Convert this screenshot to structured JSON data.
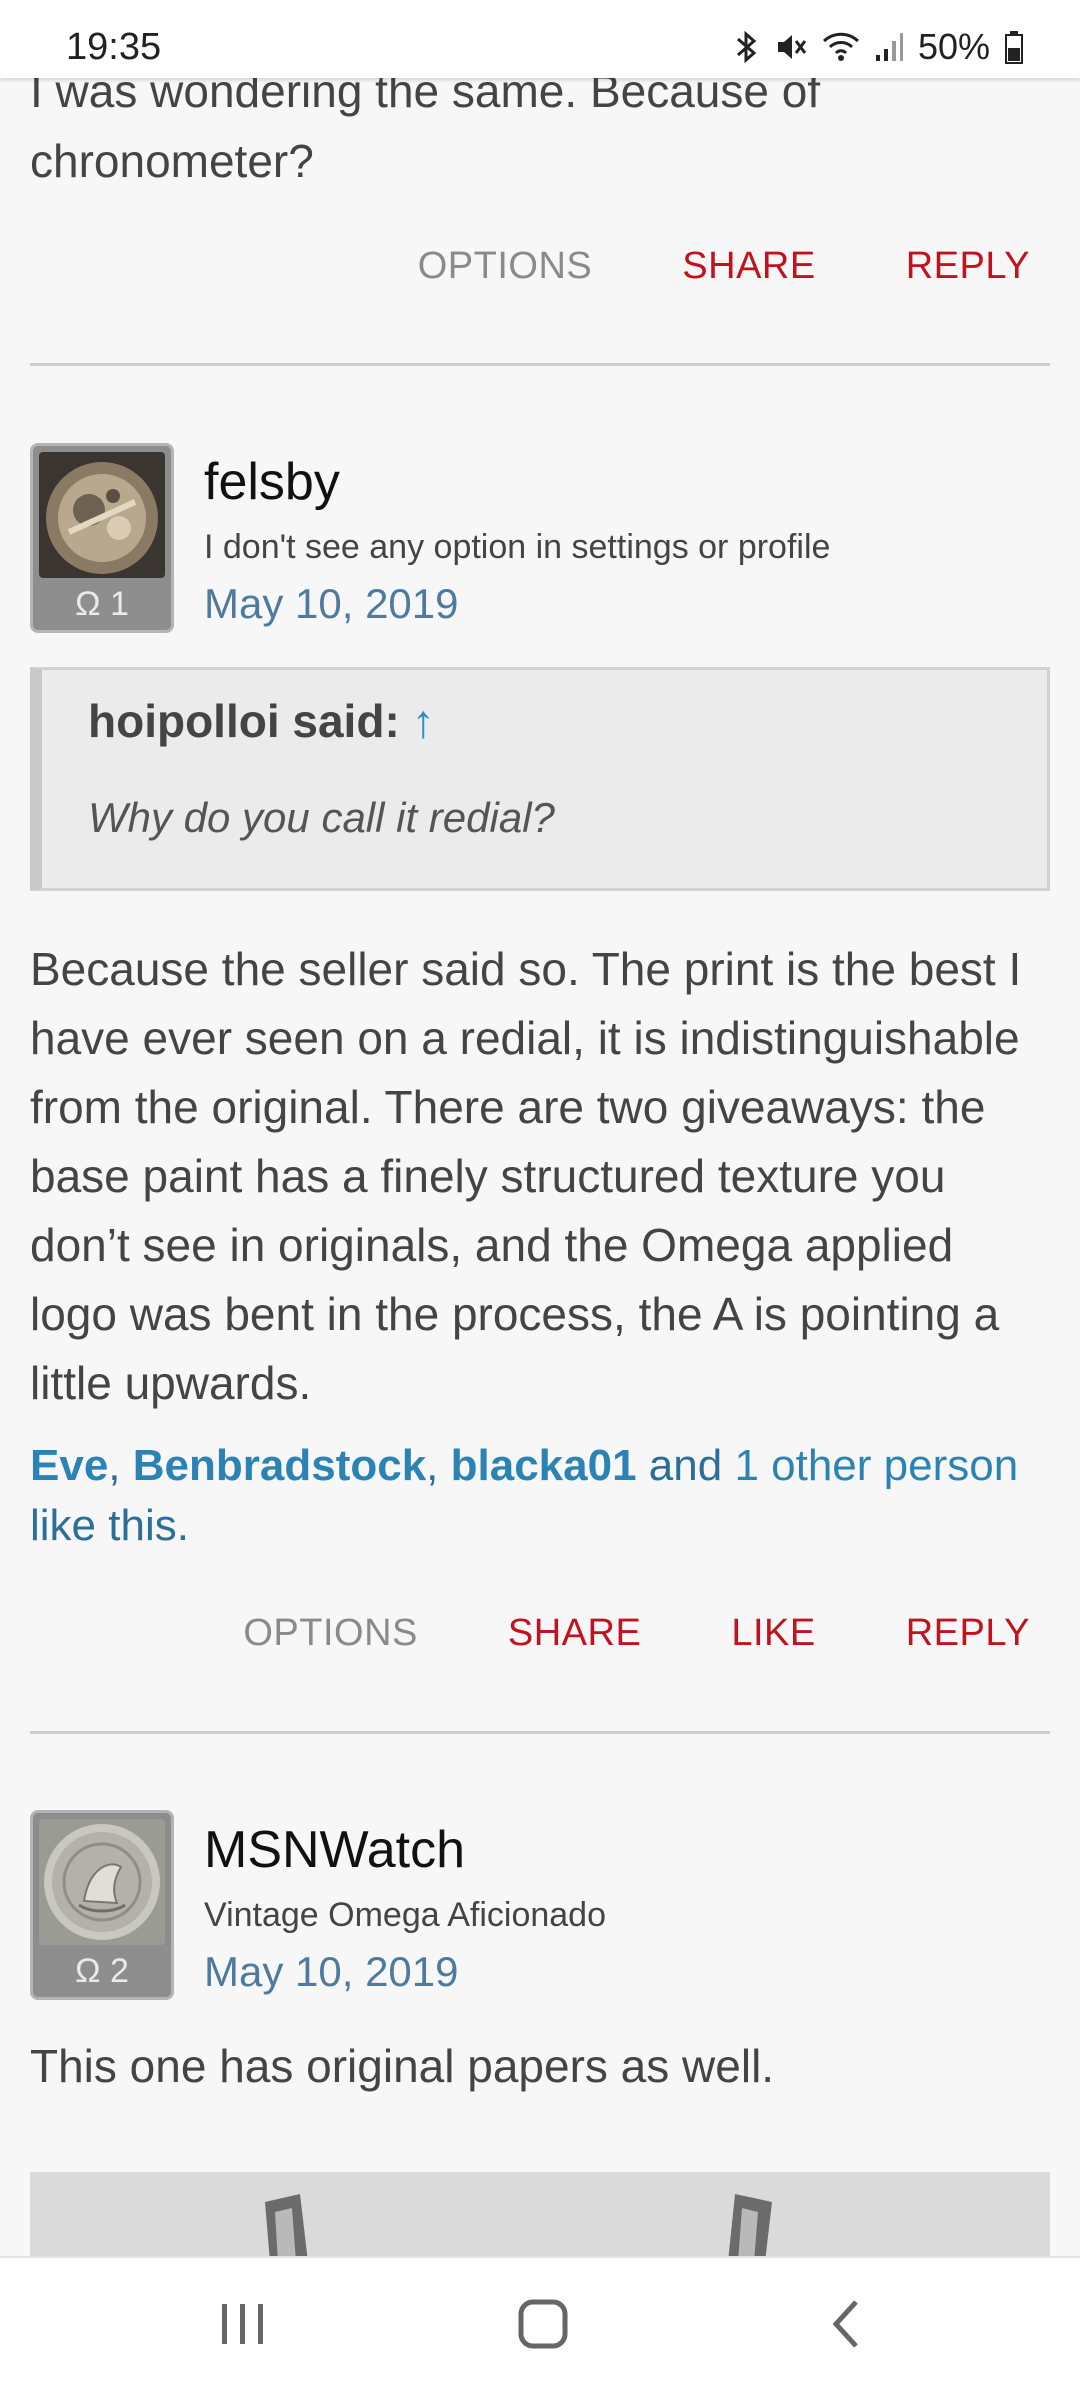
{
  "status_bar": {
    "time": "19:35",
    "battery": "50%",
    "icons": [
      "bluetooth-icon",
      "mute-icon",
      "wifi-icon",
      "signal-icon",
      "battery-icon"
    ]
  },
  "previous_post": {
    "text_line1": "I was wondering the same. Because of",
    "text_line2": "chronometer?",
    "actions": {
      "options": "OPTIONS",
      "share": "SHARE",
      "reply": "REPLY"
    }
  },
  "post1": {
    "author": "felsby",
    "user_title": "I don't see any option in settings or profile",
    "date": "May 10, 2019",
    "badge": "Ω 1",
    "quote": {
      "header": "hoipolloi said:",
      "arrow": "↑",
      "text": "Why do you call it redial?"
    },
    "body": "Because the seller said so. The print is the best I have ever seen on a redial, it is indistinguishable from the original. There are two giveaways: the base paint has a finely structured texture you don’t see in originals, and the Omega applied logo was bent in the process, the A is pointing a little upwards.",
    "likes": {
      "user1": "Eve",
      "sep1": ", ",
      "user2": "Benbradstock",
      "sep2": ", ",
      "user3": "blacka01",
      "and": " and ",
      "others": "1 other person",
      "suffix": "like this."
    },
    "actions": {
      "options": "OPTIONS",
      "share": "SHARE",
      "like": "LIKE",
      "reply": "REPLY"
    }
  },
  "post2": {
    "author": "MSNWatch",
    "user_title": "Vintage Omega Aficionado",
    "date": "May 10, 2019",
    "badge": "Ω 2",
    "body": "This one has original papers as well."
  },
  "colors": {
    "accent_red": "#c1121f",
    "link_blue": "#2b83b5",
    "date_blue": "#4e7aa0",
    "background": "#f7f7f7"
  }
}
